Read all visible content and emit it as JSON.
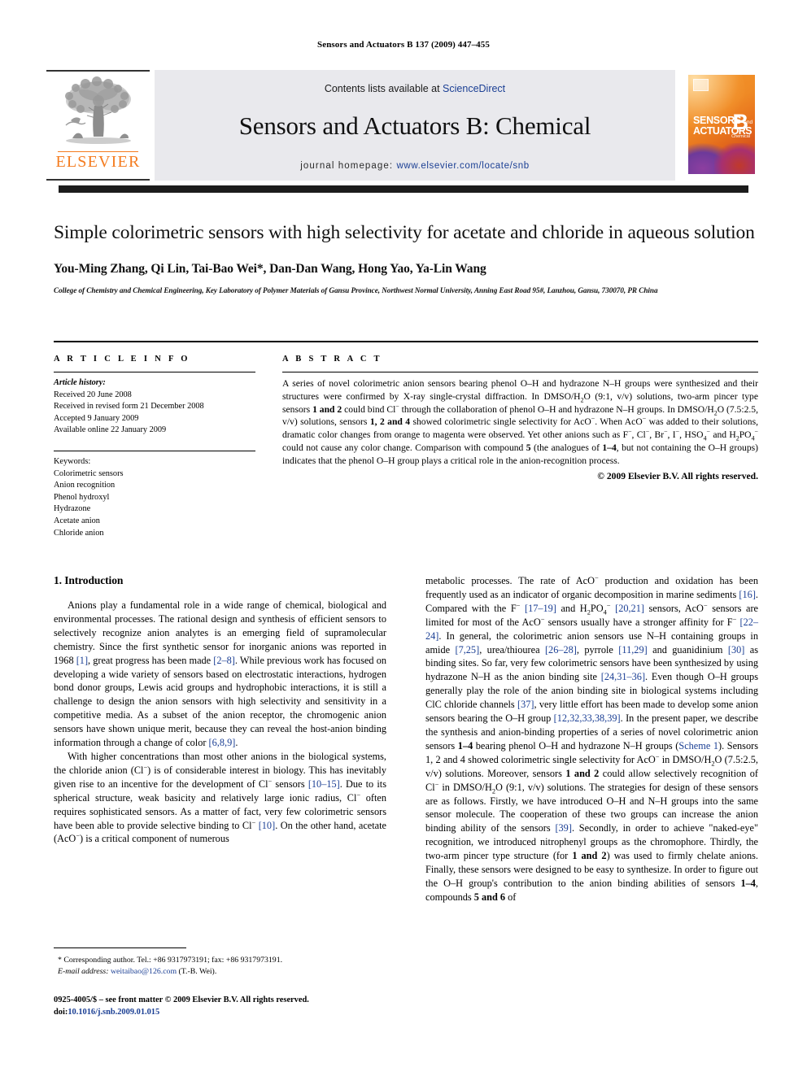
{
  "running_head": "Sensors and Actuators B 137 (2009) 447–455",
  "masthead": {
    "contents_prefix": "Contents lists available at ",
    "sciencedirect": "ScienceDirect",
    "journal_title": "Sensors and Actuators B: Chemical",
    "homepage_label": "journal homepage: ",
    "homepage_url": "www.elsevier.com/locate/snb",
    "publisher_name": "ELSEVIER",
    "cover": {
      "line1": "SENSORS",
      "line1_small": "and",
      "line2": "ACTUATORS",
      "letter": "B",
      "subtitle": "Chemical"
    },
    "accent_orange": "#f47c20",
    "link_blue": "#1b3f94",
    "panel_gray": "#e9e9ed"
  },
  "article": {
    "title": "Simple colorimetric sensors with high selectivity for acetate and chloride in aqueous solution",
    "authors": "You-Ming Zhang, Qi Lin, Tai-Bao Wei*, Dan-Dan Wang, Hong Yao, Ya-Lin Wang",
    "affiliation": "College of Chemistry and Chemical Engineering, Key Laboratory of Polymer Materials of Gansu Province, Northwest Normal University, Anning East Road 95#, Lanzhou, Gansu, 730070, PR China"
  },
  "article_info": {
    "heading": "A R T I C L E  I N F O",
    "history_label": "Article history:",
    "history": [
      "Received 20 June 2008",
      "Received in revised form 21 December 2008",
      "Accepted 9 January 2009",
      "Available online 22 January 2009"
    ],
    "keywords_label": "Keywords:",
    "keywords": [
      "Colorimetric sensors",
      "Anion recognition",
      "Phenol hydroxyl",
      "Hydrazone",
      "Acetate anion",
      "Chloride anion"
    ]
  },
  "abstract": {
    "heading": "A B S T R A C T",
    "text": "A series of novel colorimetric anion sensors bearing phenol O–H and hydrazone N–H groups were synthesized and their structures were confirmed by X-ray single-crystal diffraction. In DMSO/H2O (9:1, v/v) solutions, two-arm pincer type sensors 1 and 2 could bind Cl− through the collaboration of phenol O–H and hydrazone N–H groups. In DMSO/H2O (7.5:2.5, v/v) solutions, sensors 1, 2 and 4 showed colorimetric single selectivity for AcO−. When AcO− was added to their solutions, dramatic color changes from orange to magenta were observed. Yet other anions such as F−, Cl−, Br−, I−, HSO4− and H2PO4− could not cause any color change. Comparison with compound 5 (the analogues of 1–4, but not containing the O–H groups) indicates that the phenol O–H group plays a critical role in the anion-recognition process.",
    "copyright": "© 2009 Elsevier B.V. All rights reserved."
  },
  "introduction": {
    "heading": "1. Introduction",
    "left_paragraphs": [
      "Anions play a fundamental role in a wide range of chemical, biological and environmental processes. The rational design and synthesis of efficient sensors to selectively recognize anion analytes is an emerging field of supramolecular chemistry. Since the first synthetic sensor for inorganic anions was reported in 1968 [1], great progress has been made [2–8]. While previous work has focused on developing a wide variety of sensors based on electrostatic interactions, hydrogen bond donor groups, Lewis acid groups and hydrophobic interactions, it is still a challenge to design the anion sensors with high selectivity and sensitivity in a competitive media. As a subset of the anion receptor, the chromogenic anion sensors have shown unique merit, because they can reveal the host-anion binding information through a change of color [6,8,9].",
      "With higher concentrations than most other anions in the biological systems, the chloride anion (Cl−) is of considerable interest in biology. This has inevitably given rise to an incentive for the development of Cl− sensors [10–15]. Due to its spherical structure, weak basicity and relatively large ionic radius, Cl− often requires sophisticated sensors. As a matter of fact, very few colorimetric sensors have been able to provide selective binding to Cl− [10]. On the other hand, acetate (AcO−) is a critical component of numerous"
    ],
    "right_paragraphs": [
      "metabolic processes. The rate of AcO− production and oxidation has been frequently used as an indicator of organic decomposition in marine sediments [16]. Compared with the F− [17–19] and H2PO4− [20,21] sensors, AcO− sensors are limited for most of the AcO− sensors usually have a stronger affinity for F− [22–24]. In general, the colorimetric anion sensors use N–H containing groups in amide [7,25], urea/thiourea [26–28], pyrrole [11,29] and guanidinium [30] as binding sites. So far, very few colorimetric sensors have been synthesized by using hydrazone N–H as the anion binding site [24,31–36]. Even though O–H groups generally play the role of the anion binding site in biological systems including ClC chloride channels [37], very little effort has been made to develop some anion sensors bearing the O–H group [12,32,33,38,39]. In the present paper, we describe the synthesis and anion-binding properties of a series of novel colorimetric anion sensors 1–4 bearing phenol O–H and hydrazone N–H groups (Scheme 1). Sensors 1, 2 and 4 showed colorimetric single selectivity for AcO− in DMSO/H2O (7.5:2.5, v/v) solutions. Moreover, sensors 1 and 2 could allow selectively recognition of Cl− in DMSO/H2O (9:1, v/v) solutions. The strategies for design of these sensors are as follows. Firstly, we have introduced O–H and N–H groups into the same sensor molecule. The cooperation of these two groups can increase the anion binding ability of the sensors [39]. Secondly, in order to achieve \"naked-eye\" recognition, we introduced nitrophenyl groups as the chromophore. Thirdly, the two-arm pincer type structure (for 1 and 2) was used to firmly chelate anions. Finally, these sensors were designed to be easy to synthesize. In order to figure out the O–H group's contribution to the anion binding abilities of sensors 1–4, compounds 5 and 6 of"
    ]
  },
  "footnote": {
    "corresponding": "* Corresponding author. Tel.: +86 9317973191; fax: +86 9317973191.",
    "email_label": "E-mail address:",
    "email": "weitaibao@126.com",
    "email_suffix": "(T.-B. Wei).",
    "issn_line": "0925-4005/$ – see front matter © 2009 Elsevier B.V. All rights reserved.",
    "doi_label": "doi:",
    "doi": "10.1016/j.snb.2009.01.015"
  }
}
